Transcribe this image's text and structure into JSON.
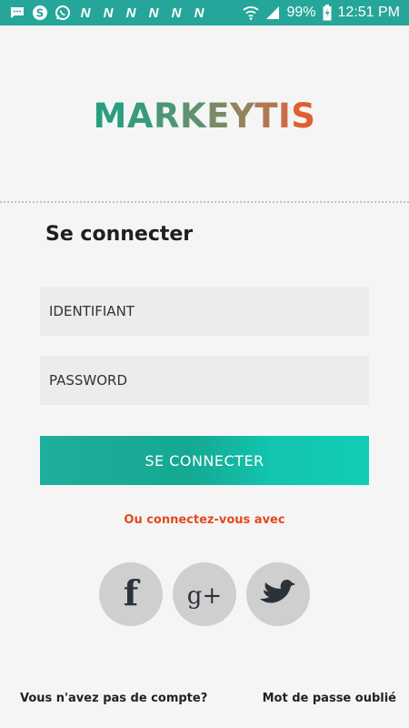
{
  "status_bar": {
    "battery": "99%",
    "time": "12:51 PM",
    "notification_n": "N"
  },
  "logo": {
    "letters": [
      {
        "char": "M",
        "color": "#2a9d7f"
      },
      {
        "char": "A",
        "color": "#3a9a7c"
      },
      {
        "char": "R",
        "color": "#4b9777"
      },
      {
        "char": "K",
        "color": "#619170"
      },
      {
        "char": "E",
        "color": "#7a8a66"
      },
      {
        "char": "Y",
        "color": "#96825c"
      },
      {
        "char": "T",
        "color": "#b27752"
      },
      {
        "char": "I",
        "color": "#cc6d45"
      },
      {
        "char": "S",
        "color": "#e05f30"
      }
    ]
  },
  "login": {
    "title": "Se connecter",
    "identifier_placeholder": "IDENTIFIANT",
    "password_placeholder": "PASSWORD",
    "submit_label": "SE CONNECTER",
    "alt_text": "Ou connectez-vous avec"
  },
  "social": {
    "facebook_glyph": "f",
    "googleplus_glyph": "g+"
  },
  "footer": {
    "no_account": "Vous n'avez pas de compte?",
    "forgot_password": "Mot de passe oublié"
  },
  "colors": {
    "status_bar": "#26a69a",
    "accent_button": "#14a892",
    "alt_text": "#e24a1c"
  }
}
